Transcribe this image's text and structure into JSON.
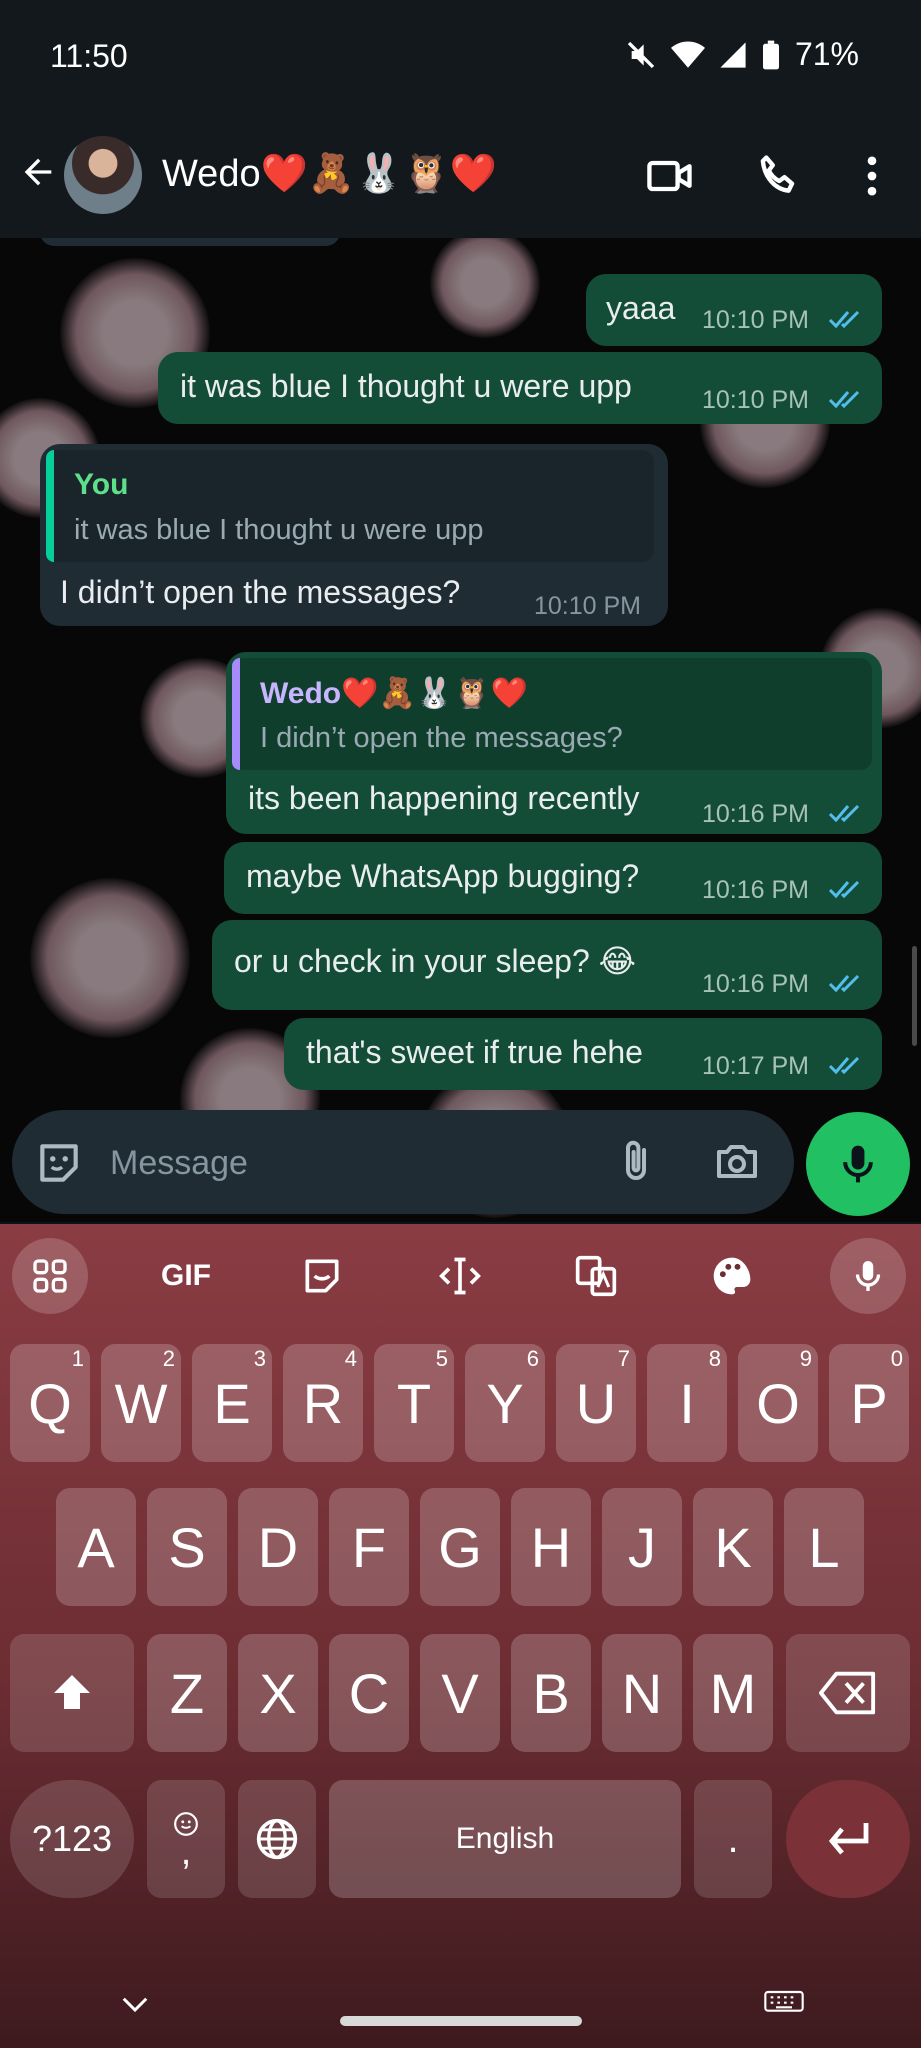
{
  "status_bar": {
    "time": "11:50",
    "battery": "71%"
  },
  "header": {
    "contact_name": "Wedo❤️🧸🐰🦉❤️"
  },
  "messages": [
    {
      "text": "yaaa",
      "time": "10:10 PM"
    },
    {
      "text": "it was blue I thought u were upp",
      "time": "10:10 PM"
    },
    {
      "quote_author": "You",
      "quote_text": "it was blue I thought u were upp",
      "text": "I didn’t open the messages?",
      "time": "10:10 PM"
    },
    {
      "quote_author": "Wedo❤️🧸🐰🦉❤️",
      "quote_text": "I didn’t open the messages?",
      "text": "its been happening recently",
      "time": "10:16 PM"
    },
    {
      "text": "maybe WhatsApp bugging?",
      "time": "10:16 PM"
    },
    {
      "text": "or u check in your sleep? 😂",
      "time": "10:16 PM"
    },
    {
      "text": "that's sweet if true hehe",
      "time": "10:17 PM"
    }
  ],
  "composer": {
    "placeholder": "Message"
  },
  "keyboard": {
    "gif_label": "GIF",
    "row1": [
      {
        "k": "Q",
        "h": "1"
      },
      {
        "k": "W",
        "h": "2"
      },
      {
        "k": "E",
        "h": "3"
      },
      {
        "k": "R",
        "h": "4"
      },
      {
        "k": "T",
        "h": "5"
      },
      {
        "k": "Y",
        "h": "6"
      },
      {
        "k": "U",
        "h": "7"
      },
      {
        "k": "I",
        "h": "8"
      },
      {
        "k": "O",
        "h": "9"
      },
      {
        "k": "P",
        "h": "0"
      }
    ],
    "row2": [
      "A",
      "S",
      "D",
      "F",
      "G",
      "H",
      "J",
      "K",
      "L"
    ],
    "row3": [
      "Z",
      "X",
      "C",
      "V",
      "B",
      "N",
      "M"
    ],
    "symbols_label": "?123",
    "comma_label": ",",
    "space_label": "English",
    "period_label": "."
  },
  "colors": {
    "outgoing": "#144d37",
    "incoming": "#1f2c34",
    "accent": "#21c063",
    "tick": "#53bdeb"
  }
}
